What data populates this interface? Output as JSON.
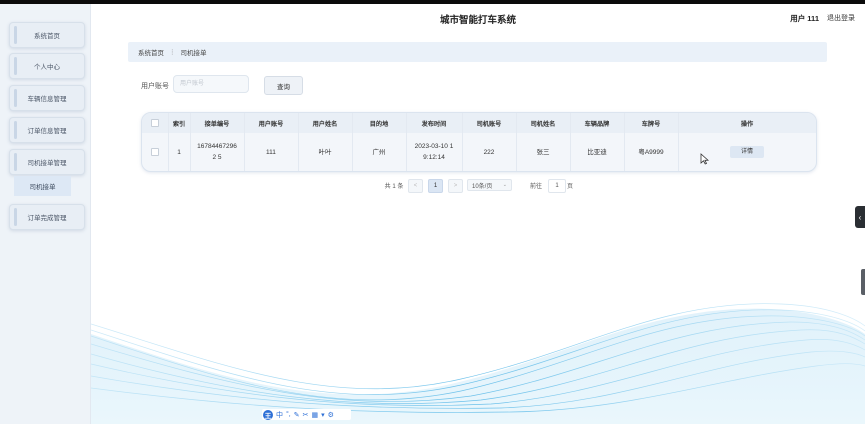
{
  "header": {
    "title": "城市智能打车系统",
    "user": "用户 111",
    "logout": "退出登录"
  },
  "sidebar": {
    "items": [
      {
        "label": "系统首页"
      },
      {
        "label": "个人中心"
      },
      {
        "label": "车辆信息管理"
      },
      {
        "label": "订单信息管理"
      },
      {
        "label": "司机接单管理"
      },
      {
        "label": "订单完成管理"
      }
    ],
    "sub_item": "司机接单"
  },
  "breadcrumb": {
    "home": "系统首页",
    "separator": "⋮",
    "current": "司机接单"
  },
  "search": {
    "label": "用户账号",
    "placeholder": "用户账号",
    "button": "查询"
  },
  "table": {
    "columns": [
      "",
      "索引",
      "接单编号",
      "用户账号",
      "用户姓名",
      "目的地",
      "发布时间",
      "司机账号",
      "司机姓名",
      "车辆品牌",
      "车牌号",
      "操作"
    ],
    "rows": [
      {
        "index": "1",
        "order_no": "167844672962 5",
        "user_account": "111",
        "user_name": "叶叶",
        "destination": "广州",
        "publish_time": "2023-03-10 1 9:12:14",
        "driver_account": "222",
        "driver_name": "张三",
        "car_brand": "比亚迪",
        "plate": "粤A9999",
        "action": "详情"
      }
    ]
  },
  "pagination": {
    "total": "共 1 条",
    "prev": "<",
    "current": "1",
    "next": ">",
    "page_size": "10条/页",
    "goto_label": "前往",
    "goto_value": "1",
    "page_suffix": "页"
  },
  "ime_toolbar": {
    "logo": "王",
    "mode": "中",
    "icons": [
      "punctuation-icon",
      "pen-icon",
      "tools-icon",
      "keyboard-icon",
      "shirt-icon",
      "gear-icon"
    ]
  },
  "colors": {
    "accent_wave": "#5ab8e8",
    "sidebar_bg": "#eef3f8",
    "table_header_bg": "#e9eff6"
  }
}
